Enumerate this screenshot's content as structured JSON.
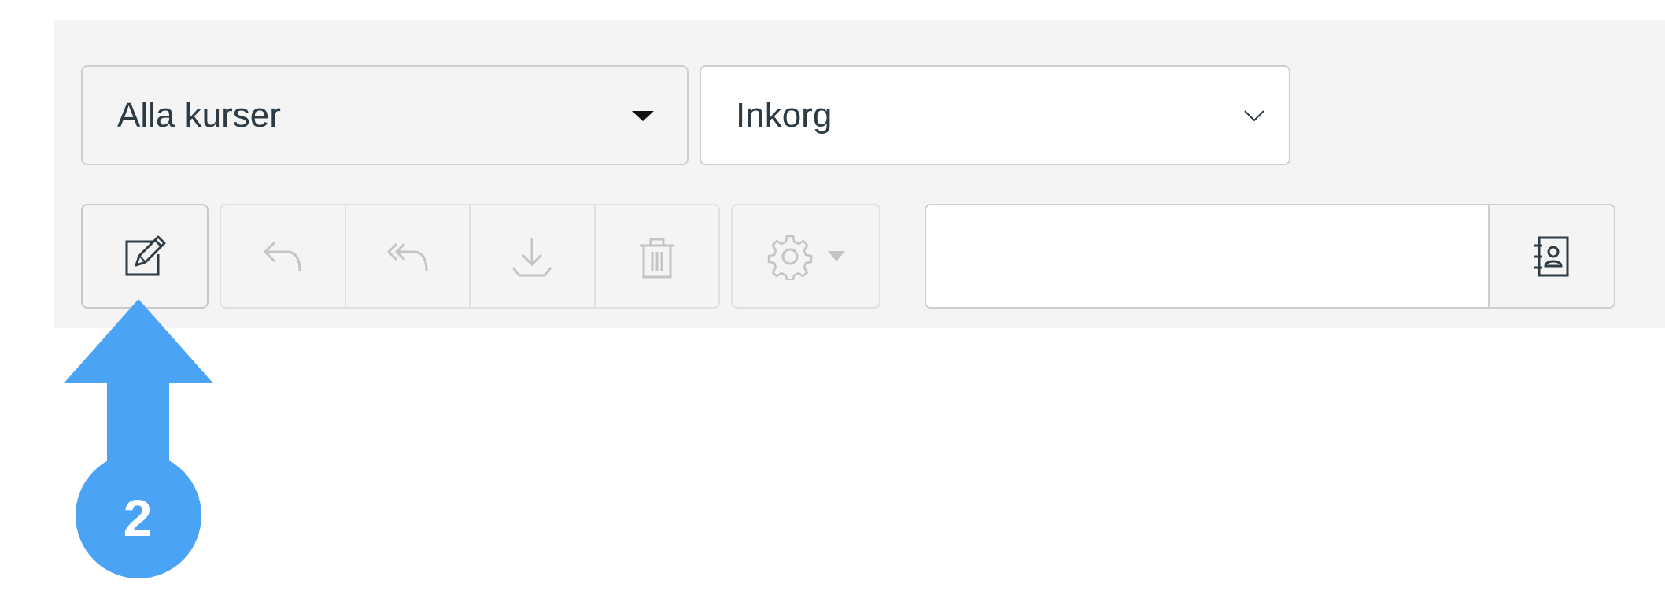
{
  "filters": {
    "course_select": {
      "value": "Alla kurser",
      "caret": "caret-down-solid-icon"
    },
    "folder_select": {
      "value": "Inkorg",
      "caret": "chevron-down-icon"
    }
  },
  "toolbar": {
    "compose": {
      "icon": "compose-icon",
      "enabled": true
    },
    "reply": {
      "icon": "reply-icon",
      "enabled": false
    },
    "reply_all": {
      "icon": "reply-all-icon",
      "enabled": false
    },
    "archive": {
      "icon": "archive-icon",
      "enabled": false
    },
    "delete": {
      "icon": "trash-icon",
      "enabled": false
    },
    "settings": {
      "icon": "gear-icon",
      "enabled": false
    }
  },
  "search": {
    "value": "",
    "placeholder": "",
    "address_book_icon": "address-book-icon"
  },
  "annotation": {
    "step_number": "2",
    "color": "#4aa3f5"
  },
  "colors": {
    "panel": "#f4f4f4",
    "text": "#2d3b45",
    "disabled_icon": "#c4c4c4",
    "icon": "#2d3b45"
  }
}
